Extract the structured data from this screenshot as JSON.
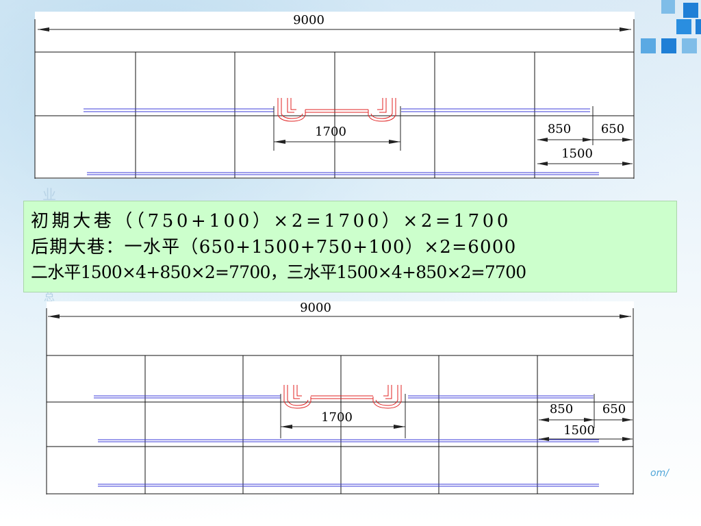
{
  "colors": {
    "dimension_line": "#222222",
    "grid_line": "#111111",
    "rail_blue": "#3b3bd9",
    "bracket_red": "#e02020",
    "panel_bg": "#ccffcc",
    "tile_blue": "#1f7fd6",
    "tile_light": "#7fbde8"
  },
  "drawing_top": {
    "total_width_label": "9000",
    "center_span_label": "1700",
    "right_dim_a": "850",
    "right_dim_b": "650",
    "right_dim_c": "1500"
  },
  "text_panel": {
    "line1": "初期大巷（（750+100）×2=1700）×2=1700",
    "line2": "后期大巷：一水平（650+1500+750+100）×2=6000",
    "line3": "二水平1500×4+850×2=7700，三水平1500×4+850×2=7700"
  },
  "drawing_bottom": {
    "total_width_label": "9000",
    "center_span_label": "1700",
    "right_dim_a": "850",
    "right_dim_b": "650",
    "right_dim_c": "1500"
  },
  "watermark_text": "om/",
  "icons": [
    "decorative-tile-icon"
  ]
}
